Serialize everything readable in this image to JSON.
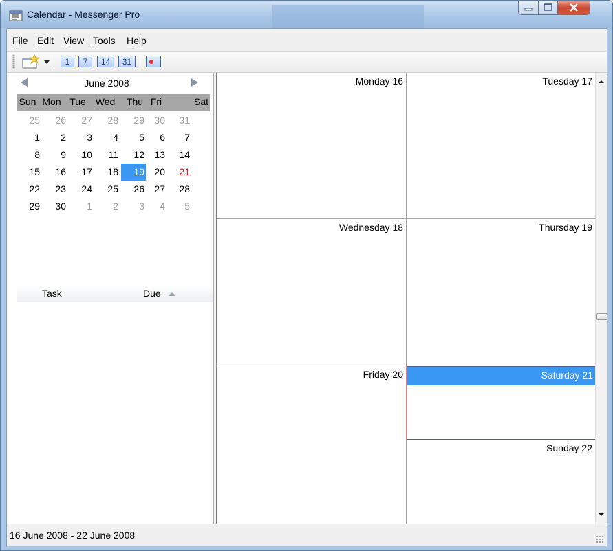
{
  "window": {
    "title": "Calendar - Messenger Pro",
    "controls": [
      "minimize-icon",
      "maximize-icon",
      "close-icon"
    ]
  },
  "menu": [
    {
      "label": "File",
      "mnemonic": "F",
      "rest": "ile"
    },
    {
      "label": "Edit",
      "mnemonic": "E",
      "rest": "dit"
    },
    {
      "label": "View",
      "mnemonic": "V",
      "rest": "iew"
    },
    {
      "label": "Tools",
      "mnemonic": "T",
      "rest": "ools"
    },
    {
      "label": "Help",
      "mnemonic": "H",
      "rest": "elp"
    }
  ],
  "toolbar": {
    "new_icon": "new-item-icon",
    "view_buttons": [
      "1",
      "7",
      "14",
      "31"
    ],
    "extra_icon": "record-icon"
  },
  "mini_calendar": {
    "title": "June 2008",
    "days_of_week": [
      "Sun",
      "Mon",
      "Tue",
      "Wed",
      "Thu",
      "Fri",
      "Sat"
    ],
    "weeks": [
      [
        "25",
        "26",
        "27",
        "28",
        "29",
        "30",
        "31"
      ],
      [
        "1",
        "2",
        "3",
        "4",
        "5",
        "6",
        "7"
      ],
      [
        "8",
        "9",
        "10",
        "11",
        "12",
        "13",
        "14"
      ],
      [
        "15",
        "16",
        "17",
        "18",
        "19",
        "20",
        "21"
      ],
      [
        "22",
        "23",
        "24",
        "25",
        "26",
        "27",
        "28"
      ],
      [
        "29",
        "30",
        "1",
        "2",
        "3",
        "4",
        "5"
      ]
    ],
    "selected": "19",
    "highlight_red": "21"
  },
  "task_list": {
    "col_task": "Task",
    "col_due": "Due"
  },
  "week_view": {
    "days": [
      {
        "label": "Monday 16"
      },
      {
        "label": "Tuesday 17"
      },
      {
        "label": "Wednesday 18"
      },
      {
        "label": "Thursday 19"
      },
      {
        "label": "Friday 20"
      },
      {
        "label": "Saturday 21"
      },
      {
        "label": "Sunday 22"
      }
    ]
  },
  "status": {
    "range": "16 June 2008 - 22 June 2008"
  },
  "colors": {
    "selection": "#3a98f2",
    "selection_border": "#e02a2a",
    "weekend_red": "#e0201b"
  }
}
